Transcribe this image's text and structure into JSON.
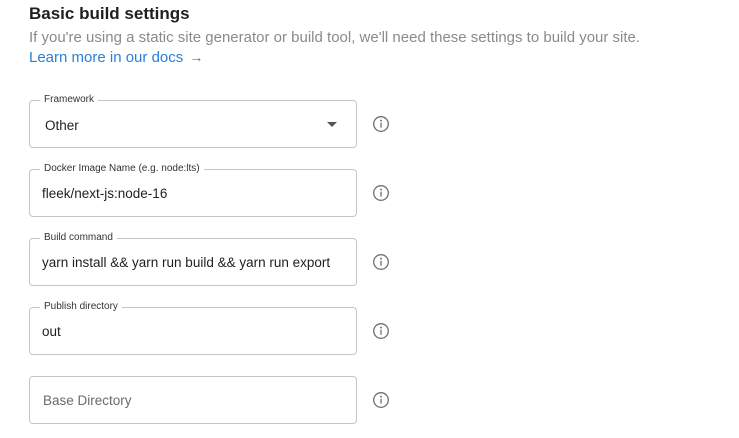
{
  "section": {
    "title": "Basic build settings",
    "description": "If you're using a static site generator or build tool, we'll need these settings to build your site.",
    "link_label": "Learn more in our docs",
    "link_arrow": "→"
  },
  "fields": {
    "framework": {
      "label": "Framework",
      "value": "Other"
    },
    "docker_image": {
      "label": "Docker Image Name (e.g. node:lts)",
      "value": "fleek/next-js:node-16"
    },
    "build_command": {
      "label": "Build command",
      "value": "yarn install && yarn run build && yarn run export"
    },
    "publish_directory": {
      "label": "Publish directory",
      "value": "out"
    },
    "base_directory": {
      "placeholder": "Base Directory",
      "value": ""
    }
  },
  "icons": {
    "info": "info-circle-icon",
    "dropdown": "caret-down-icon",
    "link_arrow": "arrow-right-icon"
  },
  "colors": {
    "link": "#2a7fd6",
    "border": "#c5c5c5",
    "muted_text": "#8a8a8a"
  }
}
